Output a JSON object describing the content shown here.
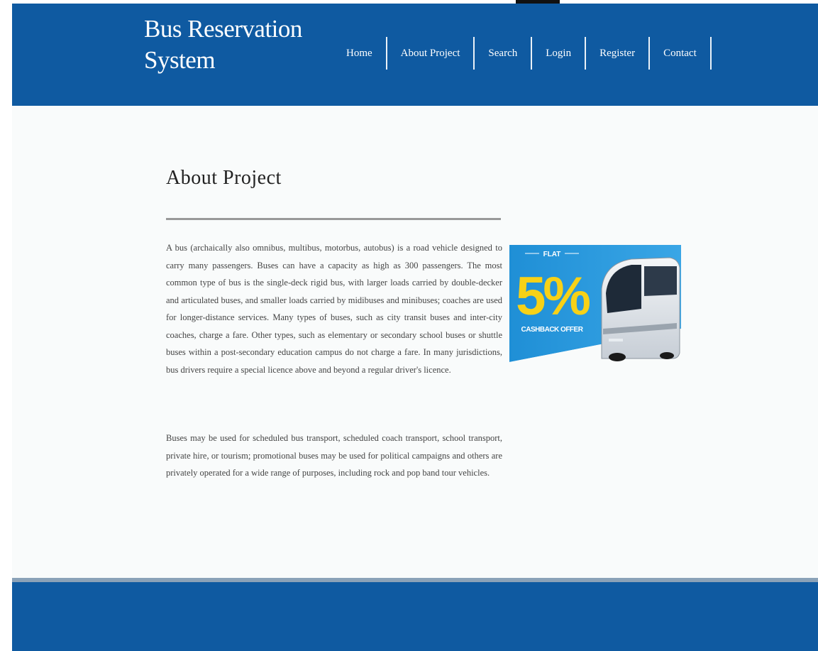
{
  "header": {
    "site_title": "Bus Reservation System",
    "nav": [
      "Home",
      "About Project",
      "Search",
      "Login",
      "Register",
      "Contact"
    ]
  },
  "main": {
    "heading": "About Project",
    "paragraphs": [
      "A bus (archaically also omnibus, multibus, motorbus, autobus) is a road vehicle designed to carry many passengers. Buses can have a capacity as high as 300 passengers. The most common type of bus is the single-deck rigid bus, with larger loads carried by double-decker and articulated buses, and smaller loads carried by midibuses and minibuses; coaches are used for longer-distance services. Many types of buses, such as city transit buses and inter-city coaches, charge a fare. Other types, such as elementary or secondary school buses or shuttle buses within a post-secondary education campus do not charge a fare. In many jurisdictions, bus drivers require a special licence above and beyond a regular driver's licence.",
      "Buses may be used for scheduled bus transport, scheduled coach transport, school transport, private hire, or tourism; promotional buses may be used for political campaigns and others are privately operated for a wide range of purposes, including rock and pop band tour vehicles."
    ],
    "promo": {
      "flat": "FLAT",
      "percent": "5%",
      "offer": "CASHBACK OFFER"
    }
  },
  "colors": {
    "header_bg": "#0f5aa1",
    "footer_bg": "#0f5aa1",
    "promo_blue": "#1f8fd6",
    "promo_yellow": "#f7d117"
  }
}
